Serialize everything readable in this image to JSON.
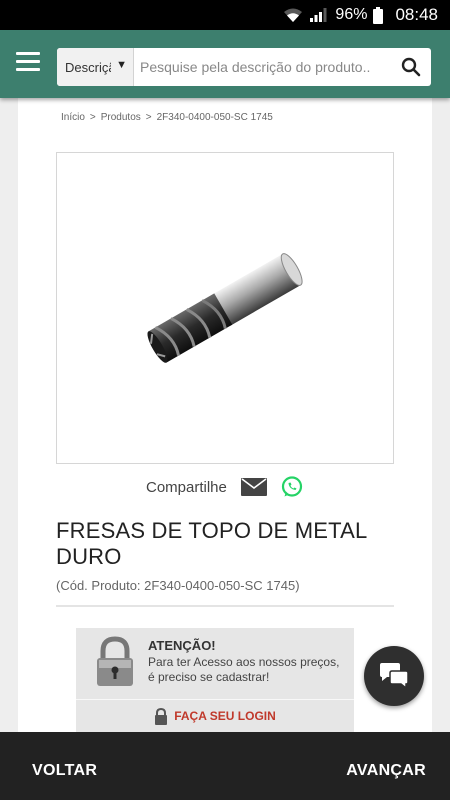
{
  "status_bar": {
    "battery": "96%",
    "time": "08:48"
  },
  "header": {
    "search_select_value": "Descrição",
    "search_placeholder": "Pesquise pela descrição do produto.."
  },
  "breadcrumb": [
    "Início",
    "Produtos",
    "2F340-0400-050-SC 1745"
  ],
  "share": {
    "label": "Compartilhe"
  },
  "product": {
    "title": "FRESAS DE TOPO DE METAL DURO",
    "code": "(Cód. Produto: 2F340-0400-050-SC 1745)"
  },
  "notice": {
    "title": "ATENÇÃO!",
    "text": "Para ter Acesso aos nossos preços, é preciso se cadastrar!",
    "login_label": "FAÇA SEU LOGIN"
  },
  "bottom_nav": {
    "back": "VOLTAR",
    "forward": "AVANÇAR"
  },
  "colors": {
    "header": "#3d7f6e",
    "login_text": "#c0392b",
    "bottom_bar": "#222222",
    "whatsapp": "#25d366"
  }
}
